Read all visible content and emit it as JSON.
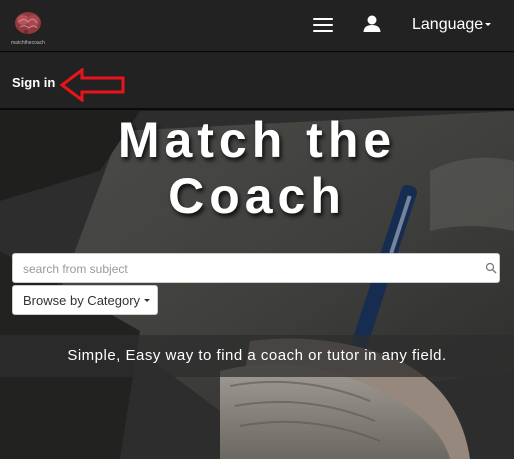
{
  "navbar": {
    "logo_text": "matchthecoach",
    "language_label": "Language",
    "icons": [
      "brain-logo",
      "hamburger-menu-icon",
      "user-icon",
      "caret-down-icon"
    ]
  },
  "subbar": {
    "signin_label": "Sign in",
    "annotation": "red-arrow-pointing-left"
  },
  "hero": {
    "title_line1": "Match the",
    "title_line2": "Coach",
    "search_placeholder": "search from subject",
    "browse_label": "Browse by Category",
    "tagline": "Simple, Easy way to find a coach or tutor in any field."
  },
  "colors": {
    "navbar_bg": "#222222",
    "arrow": "#e8141c",
    "text": "#ffffff"
  }
}
